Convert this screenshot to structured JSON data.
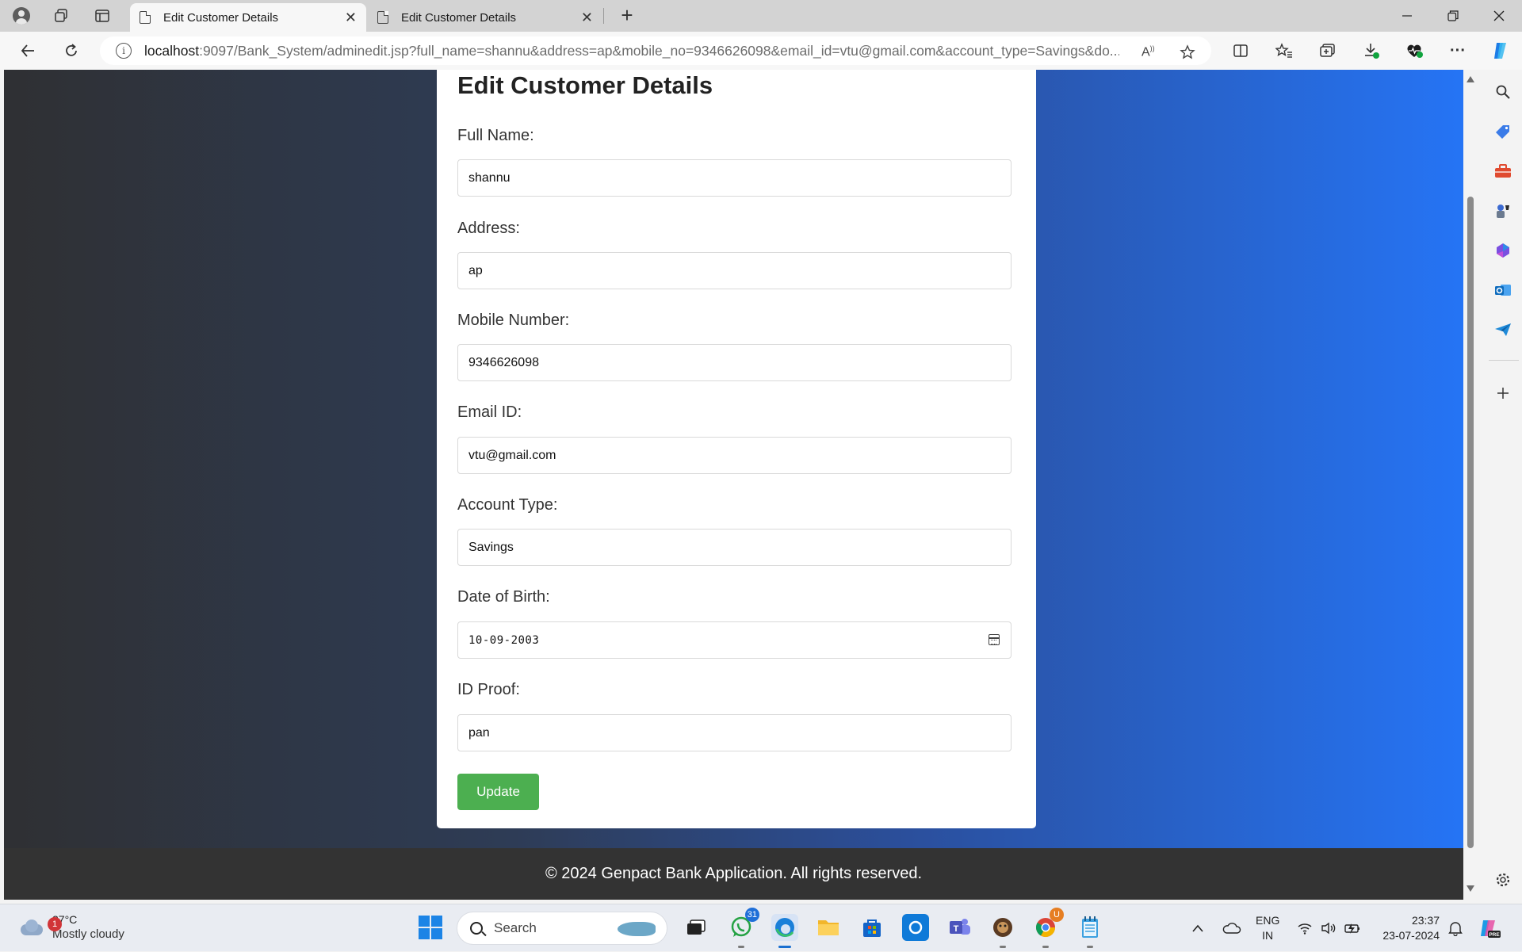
{
  "browser": {
    "tabs": [
      {
        "title": "Edit Customer Details",
        "close": "✕"
      },
      {
        "title": "Edit Customer Details",
        "close": "✕"
      }
    ],
    "new_tab": "+",
    "url_host": "localhost",
    "url_rest": ":9097/Bank_System/adminedit.jsp?full_name=shannu&address=ap&mobile_no=9346626098&email_id=vtu@gmail.com&account_type=Savings&do..."
  },
  "page": {
    "heading": "Edit Customer Details",
    "fields": [
      {
        "label": "Full Name:",
        "value": "shannu"
      },
      {
        "label": "Address:",
        "value": "ap"
      },
      {
        "label": "Mobile Number:",
        "value": "9346626098"
      },
      {
        "label": "Email ID:",
        "value": "vtu@gmail.com"
      },
      {
        "label": "Account Type:",
        "value": "Savings"
      },
      {
        "label": "Date of Birth:",
        "value": "10-09-2003"
      },
      {
        "label": "ID Proof:",
        "value": "pan"
      }
    ],
    "submit_label": "Update",
    "footer": "© 2024 Genpact Bank Application. All rights reserved."
  },
  "taskbar": {
    "weather_badge": "1",
    "weather_temp": "27°C",
    "weather_condition": "Mostly cloudy",
    "search_placeholder": "Search",
    "whatsapp_count": "31",
    "language_line1": "ENG",
    "language_line2": "IN",
    "time": "23:37",
    "date": "23-07-2024"
  },
  "colors": {
    "accent_button": "#4caf50",
    "footer_bg": "#333333",
    "gradient_end": "#2574f5"
  }
}
